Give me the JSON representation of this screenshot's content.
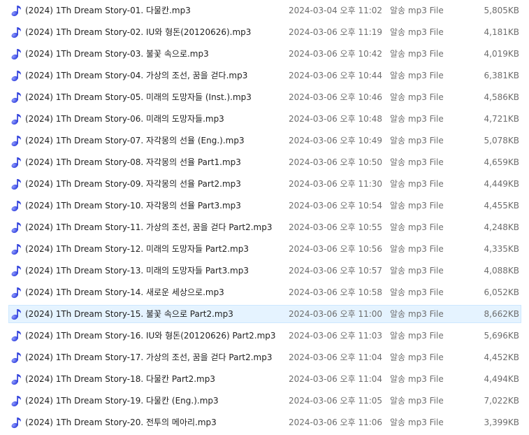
{
  "file_icon": "music-note-icon",
  "accent_color": "#2f3fdc",
  "selected_index": 14,
  "files": [
    {
      "name": "(2024) 1Th Dream Story-01. 다물칸.mp3",
      "date": "2024-03-04 오후 11:02",
      "type": "알송 mp3 File",
      "size": "5,805KB"
    },
    {
      "name": "(2024) 1Th Dream Story-02. IU와 형돈(20120626).mp3",
      "date": "2024-03-06 오후 11:19",
      "type": "알송 mp3 File",
      "size": "4,181KB"
    },
    {
      "name": "(2024) 1Th Dream Story-03. 불꽃 속으로.mp3",
      "date": "2024-03-06 오후 10:42",
      "type": "알송 mp3 File",
      "size": "4,019KB"
    },
    {
      "name": "(2024) 1Th Dream Story-04. 가상의 조선, 꿈을 걷다.mp3",
      "date": "2024-03-06 오후 10:44",
      "type": "알송 mp3 File",
      "size": "6,381KB"
    },
    {
      "name": "(2024) 1Th Dream Story-05. 미래의 도망자들 (Inst.).mp3",
      "date": "2024-03-06 오후 10:46",
      "type": "알송 mp3 File",
      "size": "4,586KB"
    },
    {
      "name": "(2024) 1Th Dream Story-06. 미래의 도망자들.mp3",
      "date": "2024-03-06 오후 10:48",
      "type": "알송 mp3 File",
      "size": "4,721KB"
    },
    {
      "name": "(2024) 1Th Dream Story-07. 자각몽의 선율 (Eng.).mp3",
      "date": "2024-03-06 오후 10:49",
      "type": "알송 mp3 File",
      "size": "5,078KB"
    },
    {
      "name": "(2024) 1Th Dream Story-08. 자각몽의 선율 Part1.mp3",
      "date": "2024-03-06 오후 10:50",
      "type": "알송 mp3 File",
      "size": "4,659KB"
    },
    {
      "name": "(2024) 1Th Dream Story-09. 자각몽의 선율 Part2.mp3",
      "date": "2024-03-06 오후 11:30",
      "type": "알송 mp3 File",
      "size": "4,449KB"
    },
    {
      "name": "(2024) 1Th Dream Story-10. 자각몽의 선율 Part3.mp3",
      "date": "2024-03-06 오후 10:54",
      "type": "알송 mp3 File",
      "size": "4,455KB"
    },
    {
      "name": "(2024) 1Th Dream Story-11. 가상의 조선, 꿈을 걷다 Part2.mp3",
      "date": "2024-03-06 오후 10:55",
      "type": "알송 mp3 File",
      "size": "4,248KB"
    },
    {
      "name": "(2024) 1Th Dream Story-12. 미래의 도망자들 Part2.mp3",
      "date": "2024-03-06 오후 10:56",
      "type": "알송 mp3 File",
      "size": "4,335KB"
    },
    {
      "name": "(2024) 1Th Dream Story-13. 미래의 도망자들 Part3.mp3",
      "date": "2024-03-06 오후 10:57",
      "type": "알송 mp3 File",
      "size": "4,088KB"
    },
    {
      "name": "(2024) 1Th Dream Story-14. 새로운 세상으로.mp3",
      "date": "2024-03-06 오후 10:58",
      "type": "알송 mp3 File",
      "size": "6,052KB"
    },
    {
      "name": "(2024) 1Th Dream Story-15. 불꽃 속으로 Part2.mp3",
      "date": "2024-03-06 오후 11:00",
      "type": "알송 mp3 File",
      "size": "8,662KB"
    },
    {
      "name": "(2024) 1Th Dream Story-16. IU와 형돈(20120626) Part2.mp3",
      "date": "2024-03-06 오후 11:03",
      "type": "알송 mp3 File",
      "size": "5,696KB"
    },
    {
      "name": "(2024) 1Th Dream Story-17. 가상의 조선, 꿈을 걷다 Part2.mp3",
      "date": "2024-03-06 오후 11:04",
      "type": "알송 mp3 File",
      "size": "4,452KB"
    },
    {
      "name": "(2024) 1Th Dream Story-18. 다물칸 Part2.mp3",
      "date": "2024-03-06 오후 11:04",
      "type": "알송 mp3 File",
      "size": "4,494KB"
    },
    {
      "name": "(2024) 1Th Dream Story-19. 다물칸 (Eng.).mp3",
      "date": "2024-03-06 오후 11:05",
      "type": "알송 mp3 File",
      "size": "7,022KB"
    },
    {
      "name": "(2024) 1Th Dream Story-20. 전투의 메아리.mp3",
      "date": "2024-03-06 오후 11:06",
      "type": "알송 mp3 File",
      "size": "3,399KB"
    }
  ]
}
